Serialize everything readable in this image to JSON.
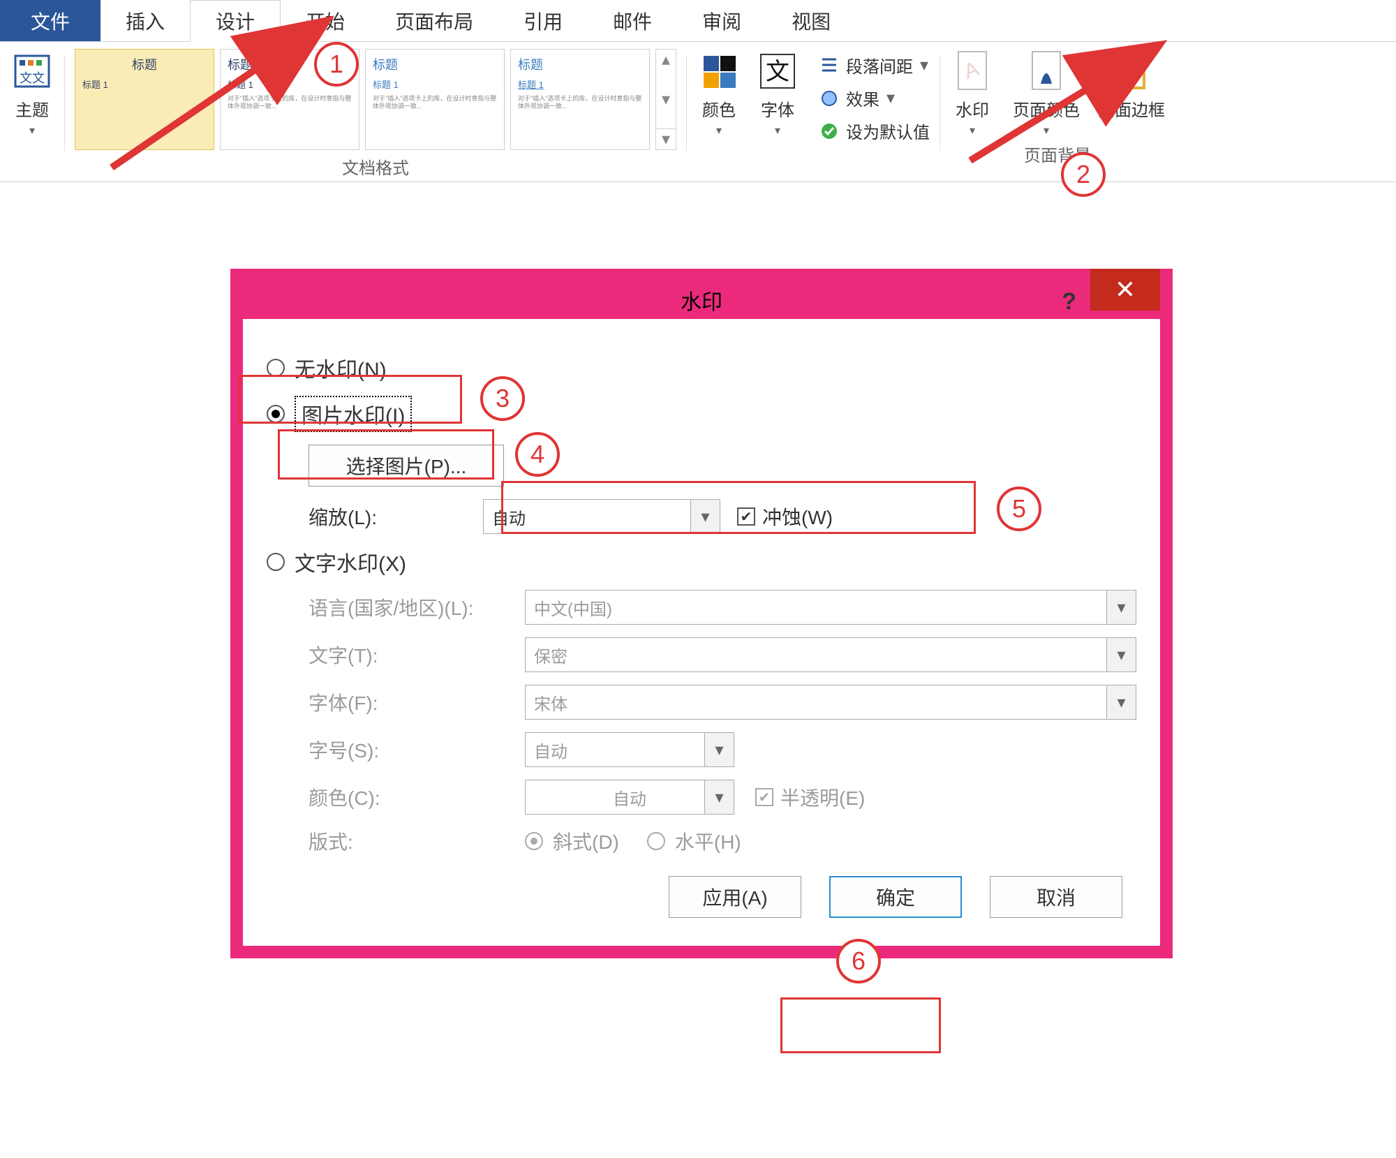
{
  "tabs": {
    "file": "文件",
    "insert": "插入",
    "design": "设计",
    "home": "开始",
    "layout": "页面布局",
    "references": "引用",
    "mailings": "邮件",
    "review": "审阅",
    "view": "视图"
  },
  "ribbon": {
    "themes_btn": "主题",
    "group_docformat": "文档格式",
    "colors": "颜色",
    "fonts": "字体",
    "paragraph_spacing": "段落间距",
    "effects": "效果",
    "set_default": "设为默认值",
    "watermark": "水印",
    "page_color": "页面颜色",
    "page_borders": "页面边框",
    "group_pagebg": "页面背景",
    "theme_card": {
      "title_big": "标题",
      "title_small": "标题 1"
    }
  },
  "dialog": {
    "title": "水印",
    "no_watermark": "无水印(N)",
    "picture_watermark": "图片水印(I)",
    "select_picture": "选择图片(P)...",
    "scale_label": "缩放(L):",
    "scale_value": "自动",
    "washout": "冲蚀(W)",
    "text_watermark": "文字水印(X)",
    "language_label": "语言(国家/地区)(L):",
    "language_value": "中文(中国)",
    "text_label": "文字(T):",
    "text_value": "保密",
    "font_label": "字体(F):",
    "font_value": "宋体",
    "size_label": "字号(S):",
    "size_value": "自动",
    "color_label": "颜色(C):",
    "color_value": "自动",
    "semitrans": "半透明(E)",
    "layout_label": "版式:",
    "diagonal": "斜式(D)",
    "horizontal": "水平(H)",
    "apply": "应用(A)",
    "ok": "确定",
    "cancel": "取消"
  },
  "callouts": {
    "c1": "1",
    "c2": "2",
    "c3": "3",
    "c4": "4",
    "c5": "5",
    "c6": "6"
  }
}
